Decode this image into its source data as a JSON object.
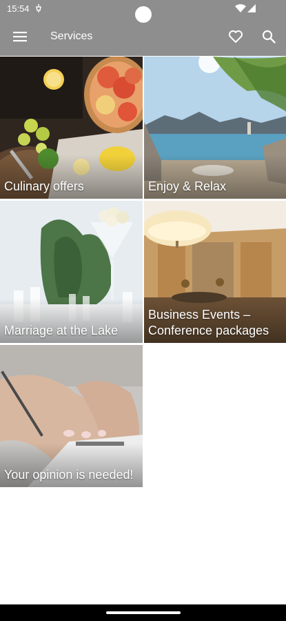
{
  "status_bar": {
    "time": "15:54",
    "icons": [
      "notification-icon",
      "wifi-icon",
      "battery-icon"
    ]
  },
  "app_bar": {
    "title": "Services",
    "menu_icon": "hamburger-menu-icon",
    "favorites_icon": "heart-icon",
    "search_icon": "search-icon"
  },
  "tiles": [
    {
      "label": "Culinary offers"
    },
    {
      "label": "Enjoy & Relax"
    },
    {
      "label": "Marriage at the Lake"
    },
    {
      "label": "Business Events – Conference packages"
    },
    {
      "label": "Your opinion is needed!"
    }
  ],
  "colors": {
    "app_bar": "#8e8e8e",
    "text_on_bar": "#ffffff",
    "background": "#ffffff"
  }
}
